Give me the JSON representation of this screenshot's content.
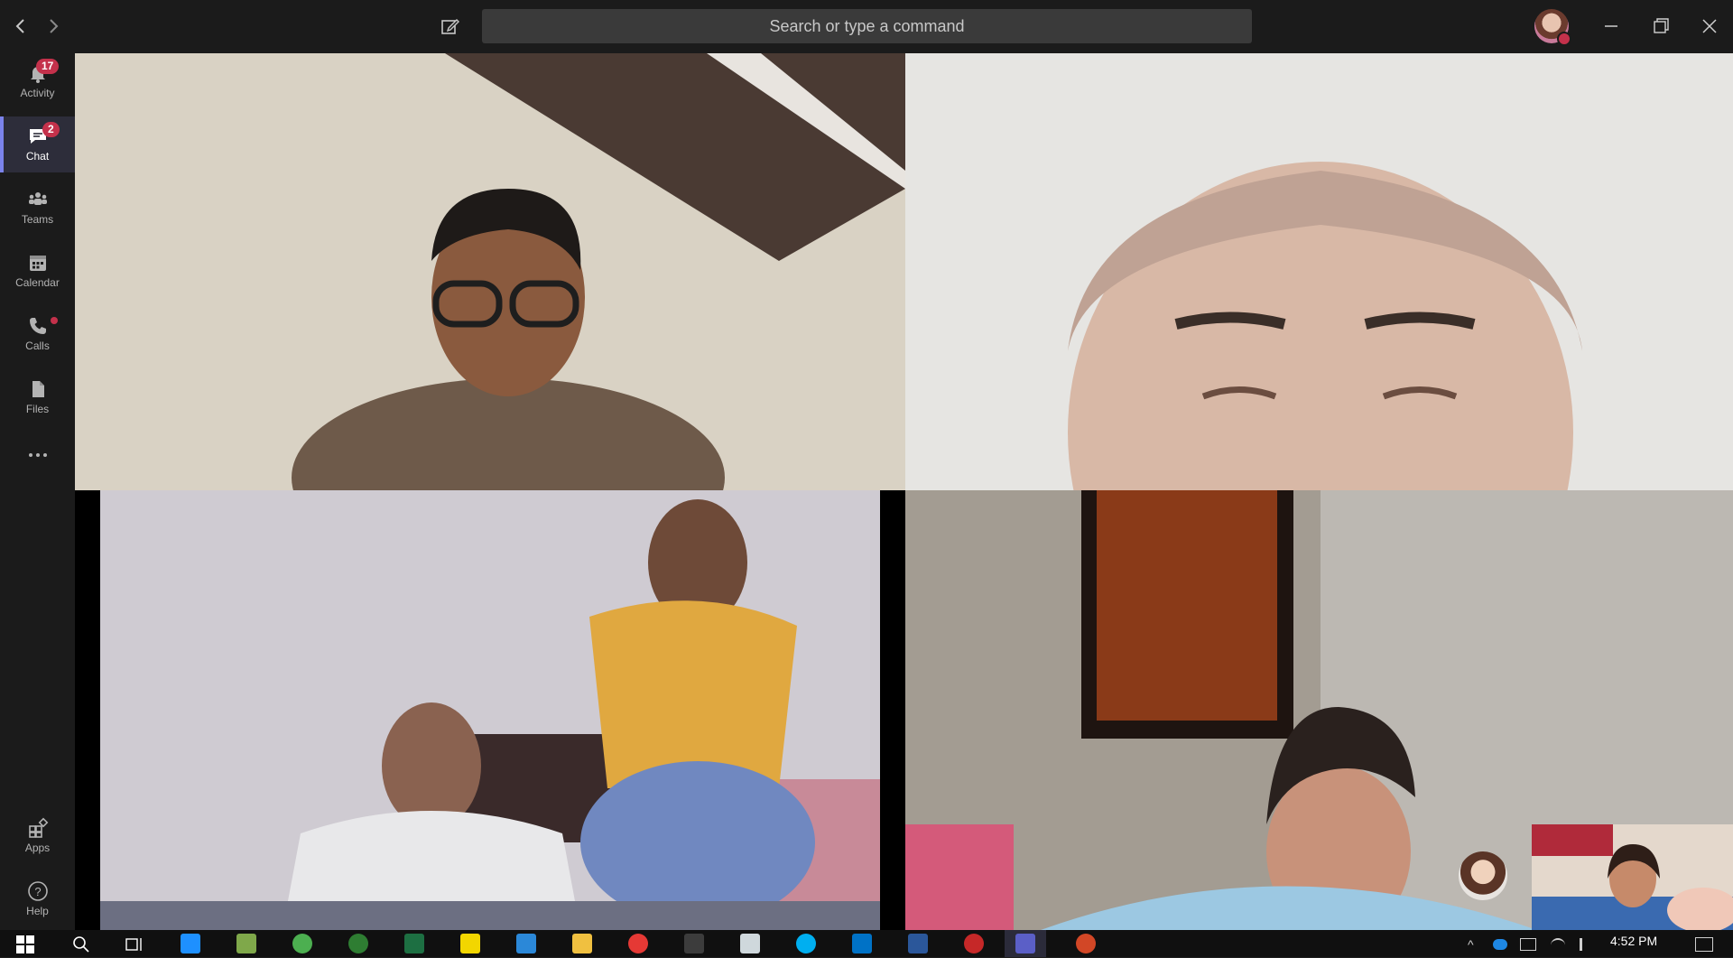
{
  "titlebar": {
    "search_placeholder": "Search or type a command",
    "back_icon": "chevron-left-icon",
    "forward_icon": "chevron-right-icon",
    "compose_icon": "compose-icon"
  },
  "rail": {
    "items": [
      {
        "label": "Activity",
        "icon": "bell-icon",
        "badge": "17"
      },
      {
        "label": "Chat",
        "icon": "chat-icon",
        "badge": "2"
      },
      {
        "label": "Teams",
        "icon": "teams-icon"
      },
      {
        "label": "Calendar",
        "icon": "calendar-icon"
      },
      {
        "label": "Calls",
        "icon": "phone-icon"
      },
      {
        "label": "Files",
        "icon": "files-icon"
      }
    ],
    "bottom": [
      {
        "label": "Apps",
        "icon": "apps-icon"
      },
      {
        "label": "Help",
        "icon": "help-icon"
      }
    ]
  },
  "call": {
    "participants": [
      {
        "slot": "top-left",
        "kind": "video"
      },
      {
        "slot": "top-right",
        "kind": "video"
      },
      {
        "slot": "bottom-left",
        "kind": "video"
      },
      {
        "slot": "bottom-right",
        "kind": "video"
      }
    ]
  },
  "taskbar": {
    "time": "4:52 PM"
  },
  "colors": {
    "accent": "#7b83eb",
    "badge": "#c4314b",
    "chrome": "#1b1b1b",
    "search": "#3a3a3a"
  }
}
